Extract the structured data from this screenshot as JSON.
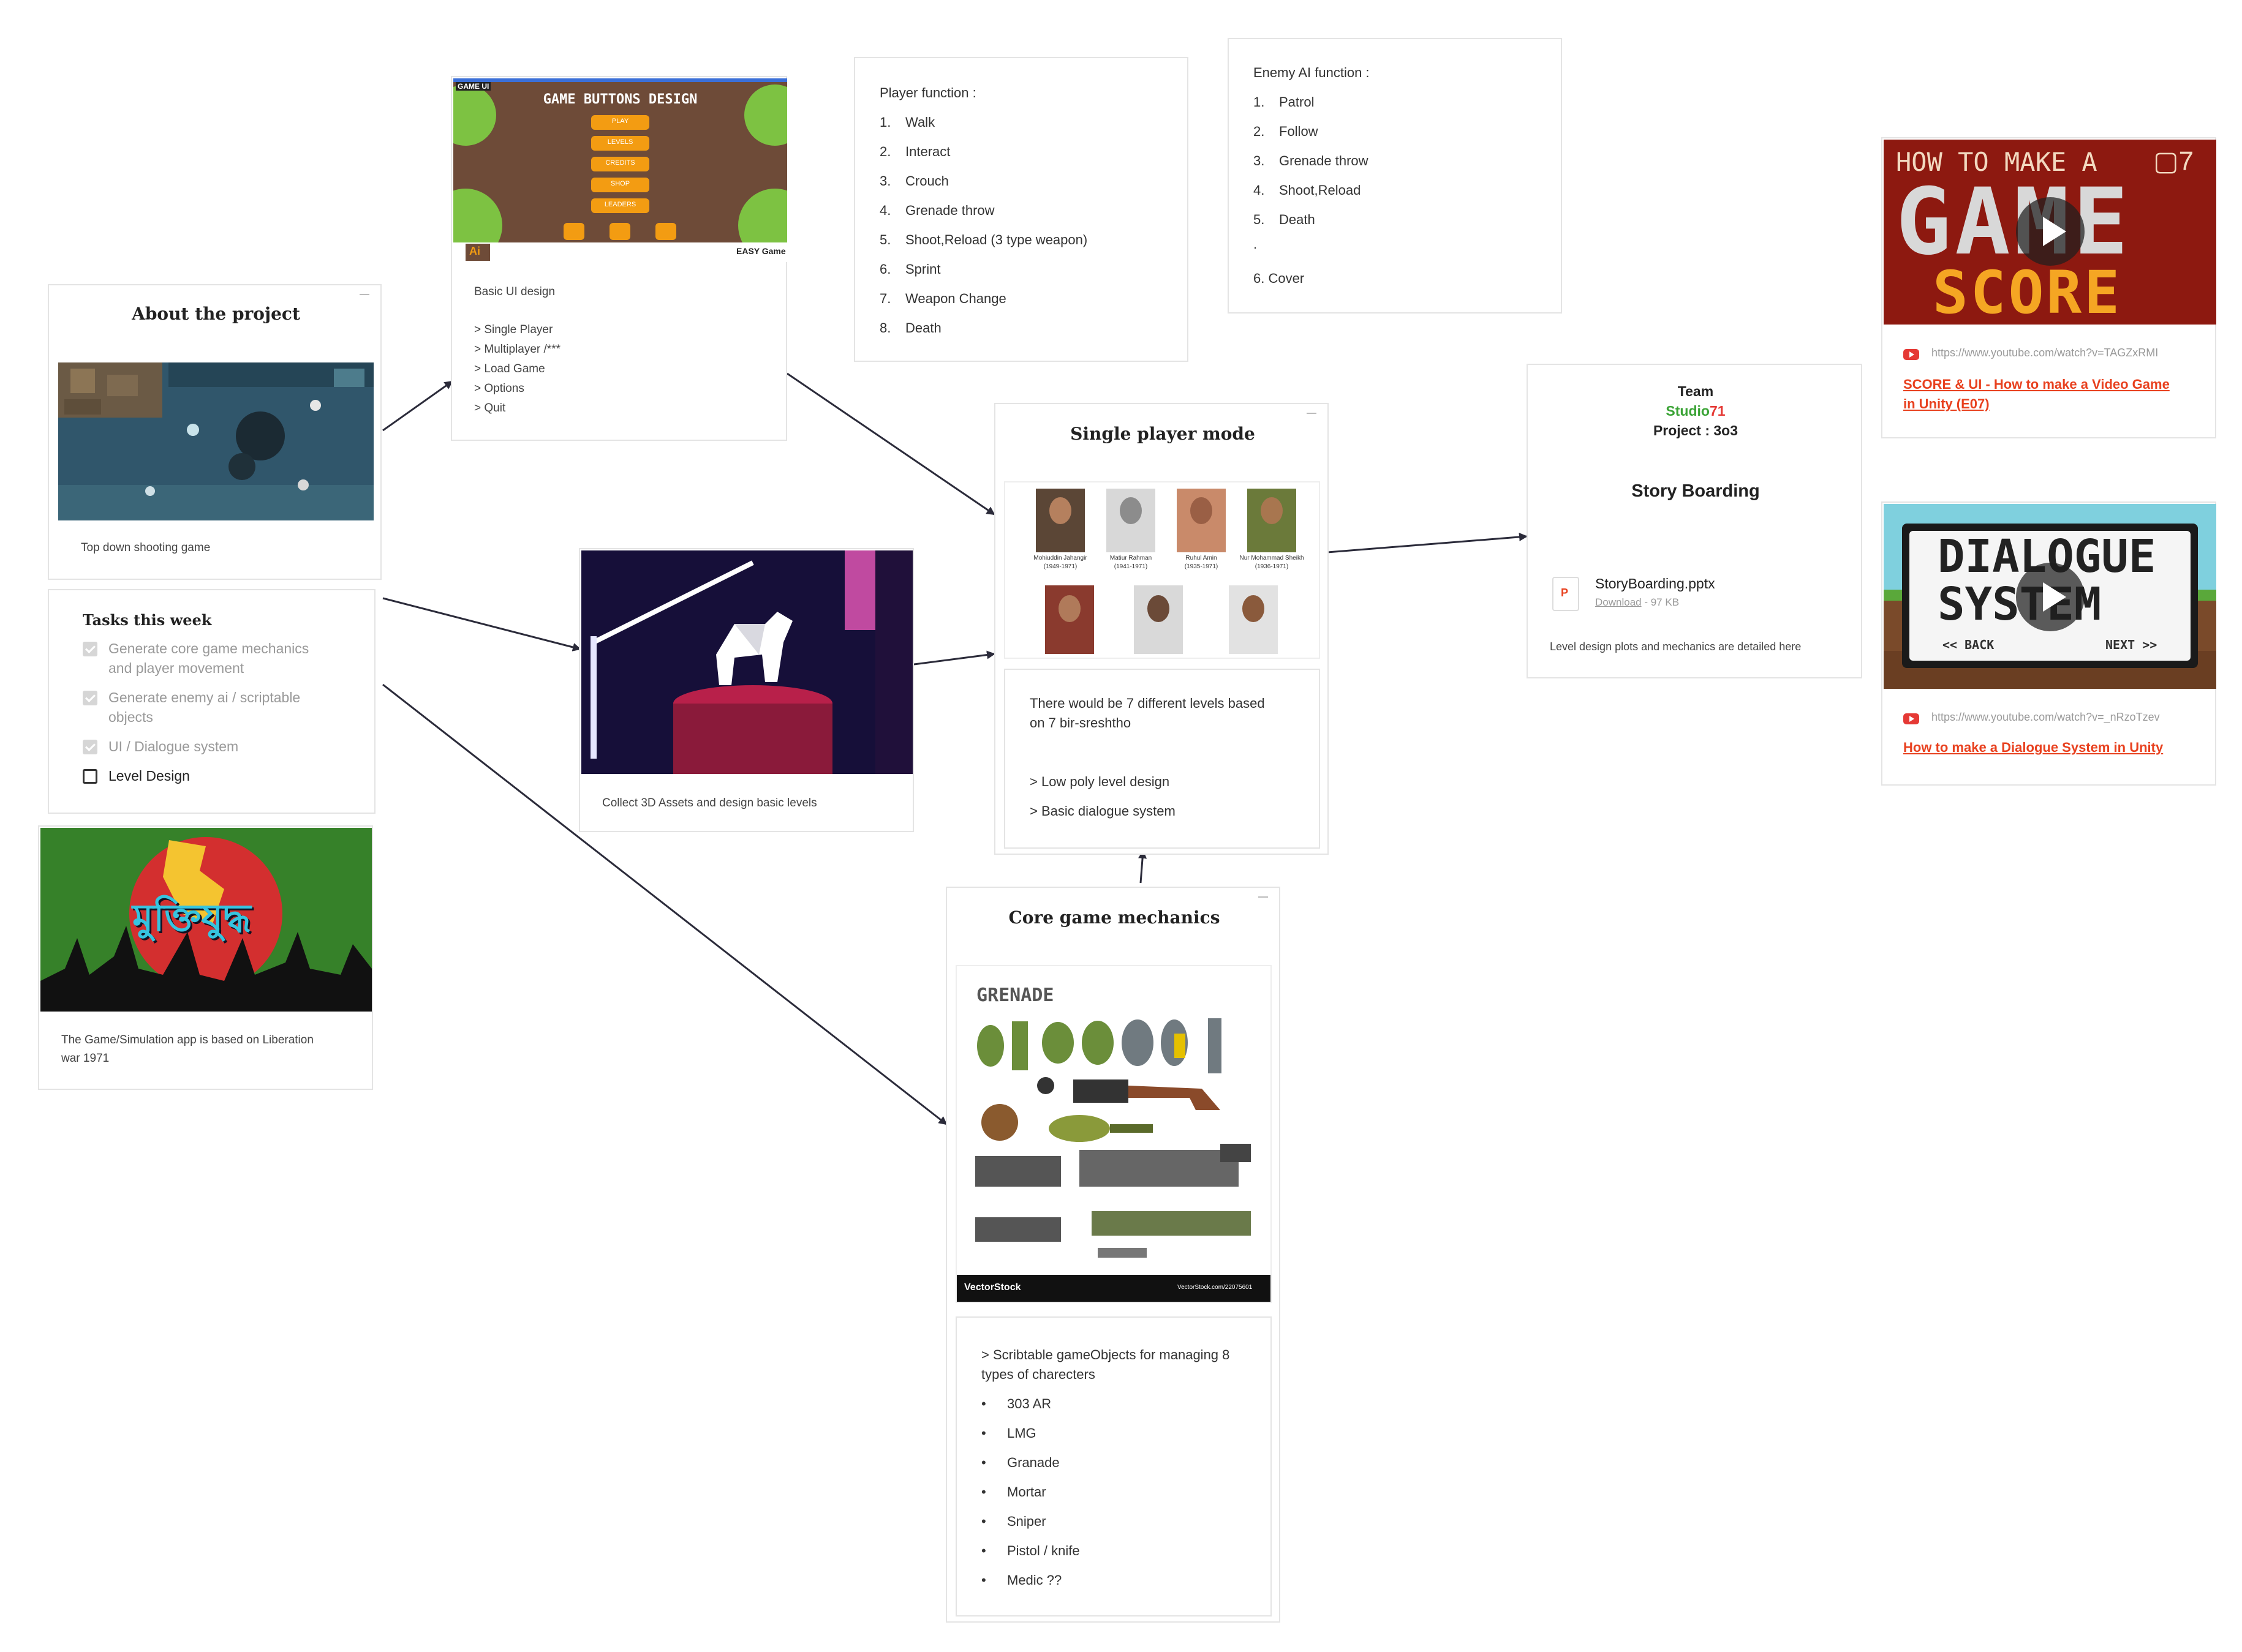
{
  "about": {
    "title": "About the project",
    "image_caption": "Top down shooting game"
  },
  "tasks": {
    "title": "Tasks this week",
    "items": [
      {
        "line1": "Generate core game mechanics",
        "line2": "and player movement",
        "done": true
      },
      {
        "line1": "Generate enemy ai / scriptable",
        "line2": "objects",
        "done": true
      },
      {
        "line1": "UI / Dialogue system",
        "line2": "",
        "done": true
      },
      {
        "line1": "Level Design",
        "line2": "",
        "done": false
      }
    ]
  },
  "liberation": {
    "banner_text": "মুক্তিযুদ্ধ",
    "caption_line1": "The Game/Simulation app is based on Liberation",
    "caption_line2": "war 1971"
  },
  "ui_design": {
    "image_title": "GAME BUTTONS DESIGN",
    "image_tag": "GAME UI",
    "image_buttons": [
      "PLAY",
      "LEVELS",
      "CREDITS",
      "SHOP",
      "LEADERS"
    ],
    "image_badge": "EASY Game",
    "ai_badge": "Ai",
    "caption": "Basic UI design",
    "items": [
      "> Single Player",
      "> Multiplayer /***",
      "> Load Game",
      "> Options",
      "> Quit"
    ]
  },
  "assets": {
    "caption": "Collect 3D Assets and design basic levels"
  },
  "player_function": {
    "title": "Player function :",
    "items": [
      "Walk",
      "Interact",
      "Crouch",
      "Grenade throw",
      "Shoot,Reload (3 type weapon)",
      "Sprint",
      "Weapon Change",
      "Death"
    ]
  },
  "enemy_ai": {
    "title": "Enemy AI function :",
    "items": [
      "Patrol",
      "Follow",
      "Grenade throw",
      "Shoot,Reload",
      "Death"
    ],
    "dot": ".",
    "extra": "6. Cover"
  },
  "single_player": {
    "title": "Single player mode",
    "portraits": [
      {
        "name": "Mohiuddin Jahangir",
        "years": "(1949-1971)"
      },
      {
        "name": "Matiur Rahman",
        "years": "(1941-1971)"
      },
      {
        "name": "Ruhul Amin",
        "years": "(1935-1971)"
      },
      {
        "name": "Nur Mohammad Sheikh",
        "years": "(1936-1971)"
      },
      {
        "name": "",
        "years": ""
      },
      {
        "name": "",
        "years": ""
      },
      {
        "name": "",
        "years": ""
      }
    ],
    "desc_line1": "There would be 7 different levels based",
    "desc_line2": "on 7 bir-sreshtho",
    "bullet1": "> Low poly level design",
    "bullet2": ">  Basic dialogue system"
  },
  "core": {
    "title": "Core game mechanics",
    "image_title": "GRENADE",
    "image_footer_left": "VectorStock",
    "image_footer_right": "VectorStock.com/22075601",
    "desc_line1": "> Scribtable gameObjects for managing 8",
    "desc_line2": "types of charecters",
    "items": [
      "303 AR",
      "LMG",
      "Granade",
      "Mortar",
      "Sniper",
      "Pistol / knife",
      "Medic ??"
    ]
  },
  "team": {
    "label": "Team",
    "studio_a": "Studio",
    "studio_b": "71",
    "project": "Project : 3o3",
    "title": "Story Boarding",
    "file_name": "StoryBoarding.pptx",
    "file_icon": "P",
    "download": "Download",
    "size": " - 97 KB",
    "note": "Level design plots and mechanics are detailed here"
  },
  "video1": {
    "thumb_line1": "HOW TO MAKE A",
    "thumb_line2": "GAME",
    "thumb_line3": "SCORE",
    "thumb_badge": "▢7",
    "url": "https://www.youtube.com/watch?v=TAGZxRMI",
    "title_line1": "SCORE & UI - How to make a Video Game",
    "title_line2": "in Unity (E07)"
  },
  "video2": {
    "thumb_line1": "DIALOGUE",
    "thumb_line2": "SYSTEM",
    "thumb_back": "<< BACK",
    "thumb_next": "NEXT >>",
    "url": "https://www.youtube.com/watch?v=_nRzoTzev",
    "title": "How to make a Dialogue System in Unity"
  },
  "colors": {
    "accent_red": "#e8401e",
    "studio_green": "#3aa335",
    "studio_red": "#e53935",
    "arrow": "#2b2b3a"
  }
}
